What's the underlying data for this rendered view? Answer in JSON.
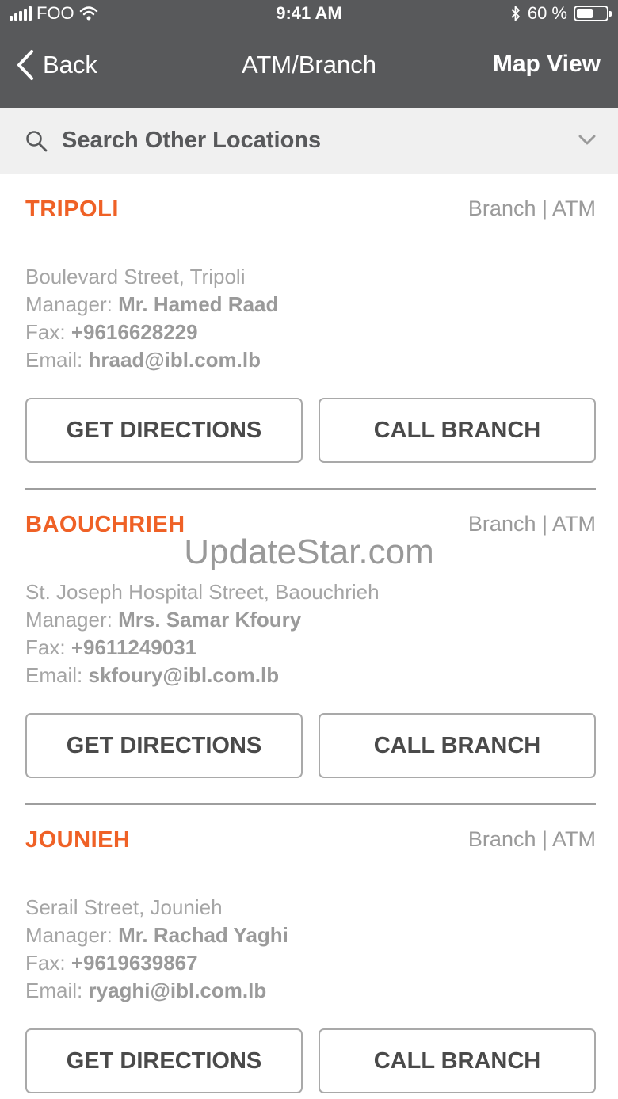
{
  "status_bar": {
    "carrier": "FOO",
    "time": "9:41 AM",
    "battery_percent": "60 %",
    "battery_level": 0.6,
    "icons": [
      "signal-icon",
      "wifi-icon",
      "bluetooth-icon",
      "battery-icon"
    ]
  },
  "nav": {
    "back_label": "Back",
    "title": "ATM/Branch",
    "map_view_label": "Map View"
  },
  "search": {
    "label": "Search Other Locations"
  },
  "branches": [
    {
      "name": "TRIPOLI",
      "type": "Branch | ATM",
      "address": "Boulevard Street, Tripoli",
      "manager_label": "Manager:",
      "manager": "Mr. Hamed Raad",
      "fax_label": "Fax:",
      "fax": "+9616628229",
      "email_label": "Email:",
      "email": "hraad@ibl.com.lb",
      "directions_label": "GET DIRECTIONS",
      "call_label": "CALL BRANCH"
    },
    {
      "name": "BAOUCHRIEH",
      "type": "Branch | ATM",
      "address": "St. Joseph Hospital Street, Baouchrieh",
      "manager_label": "Manager:",
      "manager": "Mrs. Samar Kfoury",
      "fax_label": "Fax:",
      "fax": "+9611249031",
      "email_label": "Email:",
      "email": "skfoury@ibl.com.lb",
      "directions_label": "GET DIRECTIONS",
      "call_label": "CALL BRANCH"
    },
    {
      "name": "JOUNIEH",
      "type": "Branch | ATM",
      "address": "Serail Street, Jounieh",
      "manager_label": "Manager:",
      "manager": "Mr. Rachad Yaghi",
      "fax_label": "Fax:",
      "fax": "+9619639867",
      "email_label": "Email:",
      "email": "ryaghi@ibl.com.lb",
      "directions_label": "GET DIRECTIONS",
      "call_label": "CALL BRANCH"
    }
  ],
  "watermark": "UpdateStar.com",
  "colors": {
    "header_bg": "#58595b",
    "accent_orange": "#ef6126",
    "muted_text": "#a5a5a5",
    "search_bg": "#f0f0f0"
  }
}
